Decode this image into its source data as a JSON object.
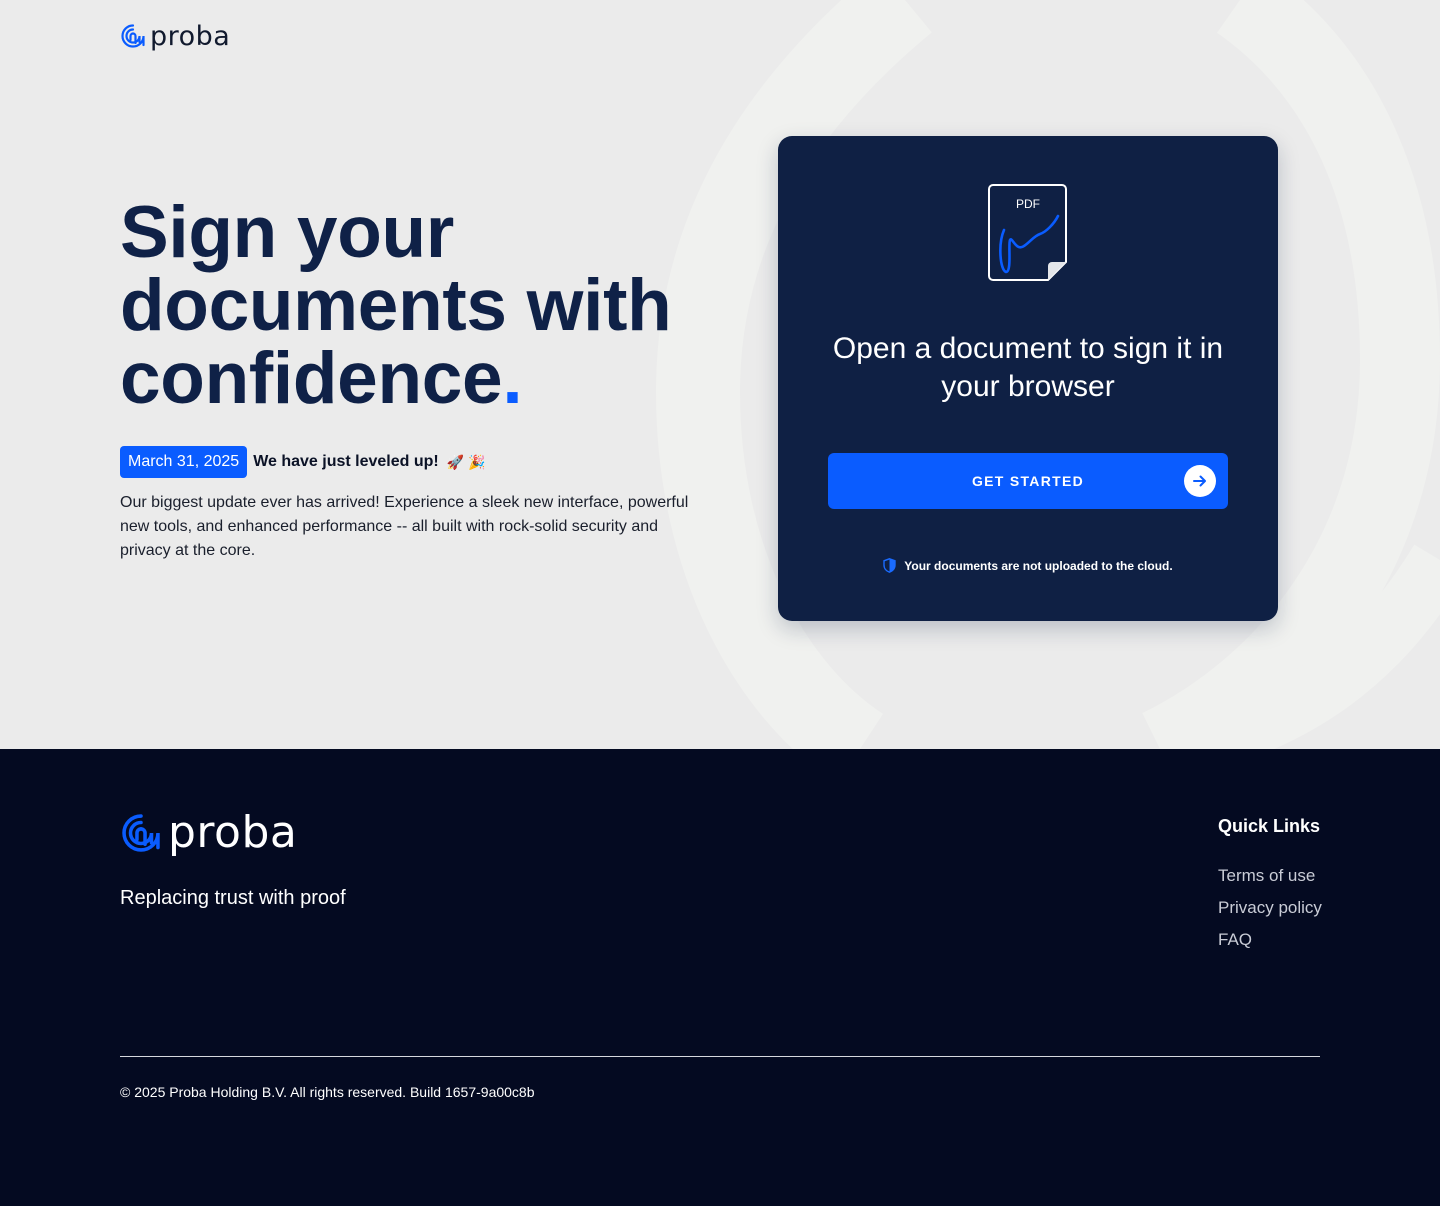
{
  "header": {
    "logo_text": "proba"
  },
  "hero": {
    "headline_line1": "Sign your",
    "headline_line2": "documents with",
    "headline_line3": "confidence",
    "headline_dot": ".",
    "news": {
      "date": "March 31, 2025",
      "title": "We have just leveled up!",
      "emoji": "🚀 🎉",
      "body": "Our biggest update ever has arrived! Experience a sleek new interface, powerful new tools, and enhanced performance -- all built with rock-solid security and privacy at the core."
    }
  },
  "card": {
    "icon_label": "PDF",
    "title": "Open a document to sign it in your browser",
    "cta_label": "GET STARTED",
    "secure_note": "Your documents are not uploaded to the cloud."
  },
  "footer": {
    "logo_text": "proba",
    "tagline": "Replacing trust with proof",
    "quick_links_title": "Quick Links",
    "quick_links": [
      {
        "label": "Terms of use"
      },
      {
        "label": "Privacy policy"
      },
      {
        "label": "FAQ"
      }
    ],
    "copyright": "© 2025 Proba Holding B.V. All rights reserved. Build 1657-9a00c8b"
  },
  "colors": {
    "accent": "#0a5cff",
    "navy": "#0f2044",
    "footer_bg": "#040a21",
    "hero_bg": "#ebebeb"
  },
  "icons": {
    "logo": "fingerprint-loop-icon",
    "card": "pdf-signature-icon",
    "cta": "arrow-right-icon",
    "secure": "shield-icon"
  }
}
